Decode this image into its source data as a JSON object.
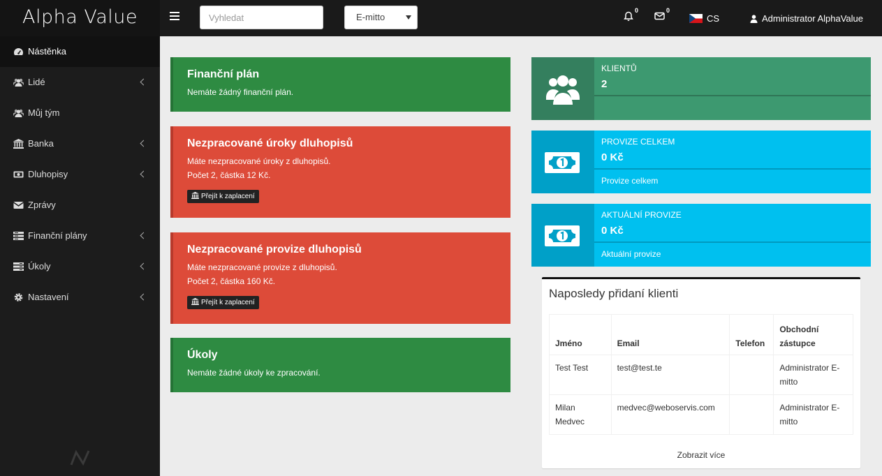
{
  "app": {
    "brand": "Alpha Value"
  },
  "topbar": {
    "search_placeholder": "Vyhledat",
    "company_selected": "E-mitto",
    "notifications_count": "0",
    "messages_count": "0",
    "language": "CS",
    "user": "Administrator AlphaValue"
  },
  "sidebar": {
    "items": [
      {
        "label": "Nástěnka",
        "icon": "dashboard-icon"
      },
      {
        "label": "Lidé",
        "icon": "users-icon"
      },
      {
        "label": "Můj tým",
        "icon": "team-icon"
      },
      {
        "label": "Banka",
        "icon": "bank-icon"
      },
      {
        "label": "Dluhopisy",
        "icon": "money-icon"
      },
      {
        "label": "Zprávy",
        "icon": "envelope-icon"
      },
      {
        "label": "Finanční plány",
        "icon": "list-icon"
      },
      {
        "label": "Úkoly",
        "icon": "tasks-icon"
      },
      {
        "label": "Nastavení",
        "icon": "gear-icon"
      }
    ]
  },
  "cards": {
    "plan": {
      "title": "Finanční plán",
      "text": "Nemáte žádný finanční plán."
    },
    "interest": {
      "title": "Nezpracované úroky dluhopisů",
      "text1": "Máte nezpracované úroky z dluhopisů.",
      "text2": "Počet 2, částka 12 Kč.",
      "button": "Přejít k zaplacení"
    },
    "commission": {
      "title": "Nezpracované provize dluhopisů",
      "text1": "Máte nezpracované provize z dluhopisů.",
      "text2": "Počet 2, částka 160 Kč.",
      "button": "Přejít k zaplacení"
    },
    "tasks": {
      "title": "Úkoly",
      "text": "Nemáte žádné úkoly ke zpracování."
    }
  },
  "info_boxes": {
    "clients": {
      "label": "KLIENTŮ",
      "value": "2",
      "desc": ""
    },
    "total_commission": {
      "label": "PROVIZE CELKEM",
      "value": "0 Kč",
      "desc": "Provize celkem"
    },
    "current_commission": {
      "label": "AKTUÁLNÍ PROVIZE",
      "value": "0 Kč",
      "desc": "Aktuální provize"
    }
  },
  "recent_clients": {
    "title": "Naposledy přidaní klienti",
    "columns": [
      "Jméno",
      "Email",
      "Telefon",
      "Obchodní zástupce"
    ],
    "rows": [
      [
        "Test Test",
        "test@test.te",
        "",
        "Administrator E-mitto"
      ],
      [
        "Milan Medvec",
        "medvec@weboservis.com",
        "",
        "Administrator E-mitto"
      ]
    ],
    "more_link": "Zobrazit více"
  },
  "colors": {
    "green": "#2e8b42",
    "red": "#dd4b39",
    "teal": "#3d9970",
    "cyan": "#00c0ef"
  }
}
